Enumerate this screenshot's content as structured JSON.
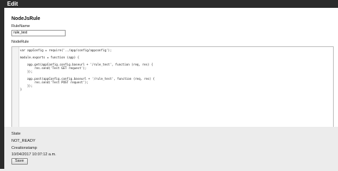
{
  "header": {
    "title": "Edit"
  },
  "form": {
    "section_title": "NodeJsRule",
    "rule_name_label": "RuleName",
    "rule_name_value": "rule_test",
    "node_rule_label": "NodeRule",
    "code_lines": [
      "var appConfig = require('../app/config/appconfig');",
      "",
      "module.exports = function (app) {",
      "",
      "    app.get(appConfig.config.baseurl + '/rule_test', function (req, res) {",
      "        res.send('Test GET request');",
      "    });",
      "",
      "    app.post(appConfig.config.baseurl + '/rule_test', function (req, res) {",
      "        res.send('Test POST request');",
      "    });",
      "}"
    ],
    "state_label": "State",
    "state_value": "NOT_READY",
    "creationstamp_label": "Creationstamp",
    "creationstamp_value": "10/04/2017 10:07:12 a.m.",
    "save_label": "Save"
  }
}
